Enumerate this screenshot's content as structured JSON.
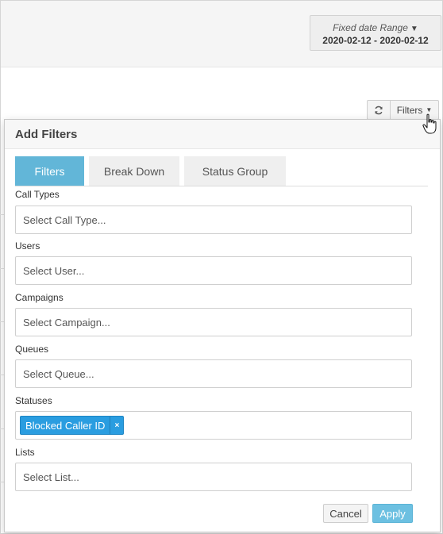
{
  "date_range": {
    "label": "Fixed date Range",
    "value": "2020-02-12 - 2020-02-12"
  },
  "toolbar": {
    "refresh_icon": "refresh-icon",
    "filters_label": "Filters"
  },
  "panel": {
    "title": "Add Filters",
    "tabs": [
      {
        "label": "Filters",
        "active": true
      },
      {
        "label": "Break Down",
        "active": false
      },
      {
        "label": "Status Group",
        "active": false
      }
    ],
    "fields": {
      "call_types": {
        "label": "Call Types",
        "placeholder": "Select Call Type..."
      },
      "users": {
        "label": "Users",
        "placeholder": "Select User..."
      },
      "campaigns": {
        "label": "Campaigns",
        "placeholder": "Select Campaign..."
      },
      "queues": {
        "label": "Queues",
        "placeholder": "Select Queue..."
      },
      "statuses": {
        "label": "Statuses",
        "selected": [
          "Blocked Caller ID"
        ],
        "remove_glyph": "×"
      },
      "lists": {
        "label": "Lists",
        "placeholder": "Select List..."
      }
    },
    "cancel_label": "Cancel",
    "apply_label": "Apply"
  },
  "colors": {
    "active_tab": "#62b6d8",
    "tag": "#2a9de0",
    "apply": "#6cc0e1"
  }
}
